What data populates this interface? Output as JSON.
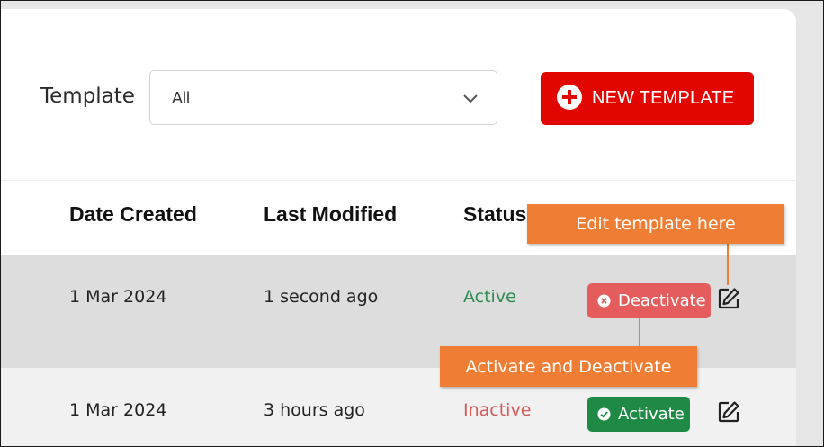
{
  "filter": {
    "label": "Template",
    "selected": "All"
  },
  "toolbar": {
    "new_template_label": "NEW TEMPLATE"
  },
  "table": {
    "columns": [
      "Date Created",
      "Last Modified",
      "Status"
    ],
    "rows": [
      {
        "date_created": "1 Mar 2024",
        "last_modified": "1 second ago",
        "status": "Active",
        "action_label": "Deactivate"
      },
      {
        "date_created": "1 Mar 2024",
        "last_modified": "3 hours ago",
        "status": "Inactive",
        "action_label": "Activate"
      }
    ]
  },
  "annotations": {
    "edit": "Edit template here",
    "activate": "Activate and Deactivate"
  },
  "colors": {
    "brand_red": "#e10600",
    "active_green": "#2e8b4e",
    "inactive_red": "#d65a5a",
    "deactivate_pill": "#e45c5c",
    "activate_pill": "#1f8a45",
    "callout_orange": "#f07d34"
  },
  "icons": {
    "new_template": "plus-circle-icon",
    "dropdown": "chevron-down-icon",
    "deactivate": "x-circle-icon",
    "activate": "check-circle-icon",
    "edit": "edit-icon"
  }
}
